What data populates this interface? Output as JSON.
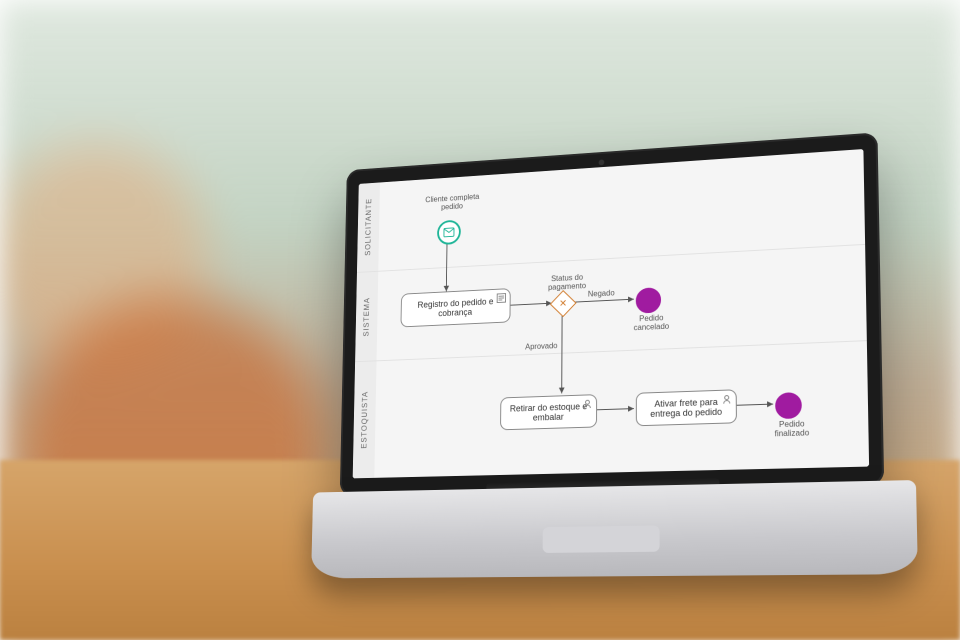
{
  "chart_data": {
    "type": "bpmn_swimlane",
    "lanes": [
      "SOLICITANTE",
      "SISTEMA",
      "ESTOQUISTA"
    ],
    "nodes": [
      {
        "id": "start",
        "lane": "SOLICITANTE",
        "type": "start-message",
        "label": "Cliente completa pedido"
      },
      {
        "id": "registro",
        "lane": "SISTEMA",
        "type": "user-task",
        "label": "Registro do pedido e cobrança"
      },
      {
        "id": "gw",
        "lane": "SISTEMA",
        "type": "exclusive-gateway",
        "label": "Status do pagamento"
      },
      {
        "id": "end_canc",
        "lane": "SISTEMA",
        "type": "end",
        "label": "Pedido cancelado"
      },
      {
        "id": "retirar",
        "lane": "ESTOQUISTA",
        "type": "user-task",
        "label": "Retirar do estoque e embalar"
      },
      {
        "id": "ativar",
        "lane": "ESTOQUISTA",
        "type": "user-task",
        "label": "Ativar frete para entrega do pedido"
      },
      {
        "id": "end_fin",
        "lane": "ESTOQUISTA",
        "type": "end",
        "label": "Pedido finalizado"
      }
    ],
    "edges": [
      {
        "from": "start",
        "to": "registro"
      },
      {
        "from": "registro",
        "to": "gw"
      },
      {
        "from": "gw",
        "to": "end_canc",
        "label": "Negado"
      },
      {
        "from": "gw",
        "to": "retirar",
        "label": "Aprovado"
      },
      {
        "from": "retirar",
        "to": "ativar"
      },
      {
        "from": "ativar",
        "to": "end_fin"
      }
    ]
  },
  "lanes": {
    "0": "SOLICITANTE",
    "1": "SISTEMA",
    "2": "ESTOQUISTA"
  },
  "startEvent": {
    "label": "Cliente completa pedido"
  },
  "task_registro": "Registro do pedido e cobrança",
  "gateway": {
    "label": "Status do pagamento"
  },
  "edge_negado": "Negado",
  "edge_aprovado": "Aprovado",
  "end_cancelado": "Pedido cancelado",
  "task_retirar": "Retirar do estoque e embalar",
  "task_ativar": "Ativar frete para entrega do pedido",
  "end_finalizado": "Pedido finalizado",
  "colors": {
    "start_stroke": "#1fb598",
    "end_fill": "#a01ba0",
    "gateway_stroke": "#d07a2a",
    "lane_bg": "#f5f5f5"
  }
}
